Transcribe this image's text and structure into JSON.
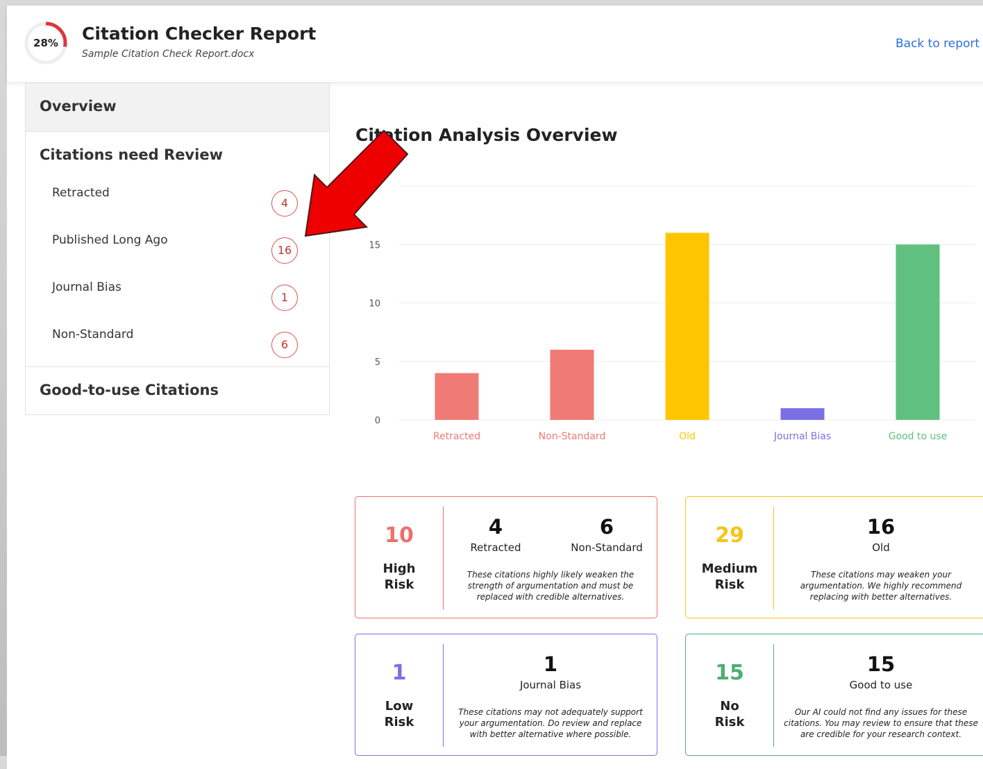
{
  "header": {
    "progress_label": "28%",
    "progress_value": 0.28,
    "title": "Citation Checker Report",
    "subtitle": "Sample Citation Check Report.docx",
    "back_link": "Back to report"
  },
  "sidebar": {
    "overview": "Overview",
    "review_section": "Citations need Review",
    "items": [
      {
        "label": "Retracted",
        "count": "4"
      },
      {
        "label": "Published Long Ago",
        "count": "16"
      },
      {
        "label": "Journal Bias",
        "count": "1"
      },
      {
        "label": "Non-Standard",
        "count": "6"
      }
    ],
    "good_section": "Good-to-use Citations"
  },
  "main": {
    "title": "Citation Analysis Overview"
  },
  "chart_data": {
    "type": "bar",
    "categories": [
      "Retracted",
      "Non-Standard",
      "Old",
      "Journal Bias",
      "Good to use"
    ],
    "values": [
      4,
      6,
      16,
      1,
      15
    ],
    "colors": [
      "#f07a74",
      "#f07a74",
      "#ffc600",
      "#7b6fe6",
      "#5fc07f"
    ],
    "yticks": [
      0,
      5,
      10,
      15
    ],
    "ylim": [
      0,
      20
    ],
    "grid": true
  },
  "cards": [
    {
      "big": "10",
      "risk_line1": "High",
      "risk_line2": "Risk",
      "color": "#ef6f6c",
      "metrics": [
        {
          "n": "4",
          "l": "Retracted"
        },
        {
          "n": "6",
          "l": "Non-Standard"
        }
      ],
      "desc": "These citations highly likely weaken the strength of argumentation and must be replaced with credible alternatives."
    },
    {
      "big": "29",
      "risk_line1": "Medium",
      "risk_line2": "Risk",
      "color": "#f5c518",
      "metrics": [
        {
          "n": "16",
          "l": "Old"
        }
      ],
      "desc": "These citations may weaken your argumentation. We highly recommend replacing with better alternatives."
    },
    {
      "big": "1",
      "risk_line1": "Low",
      "risk_line2": "Risk",
      "color": "#7b6fe6",
      "metrics": [
        {
          "n": "1",
          "l": "Journal Bias"
        }
      ],
      "desc": "These citations may not adequately support your argumentation. Do review and replace with better alternative where possible."
    },
    {
      "big": "15",
      "risk_line1": "No",
      "risk_line2": "Risk",
      "color": "#4caf72",
      "metrics": [
        {
          "n": "15",
          "l": "Good to use"
        }
      ],
      "desc": "Our AI could not find any issues for these citations. You may review to ensure that these are credible for your research context."
    }
  ]
}
